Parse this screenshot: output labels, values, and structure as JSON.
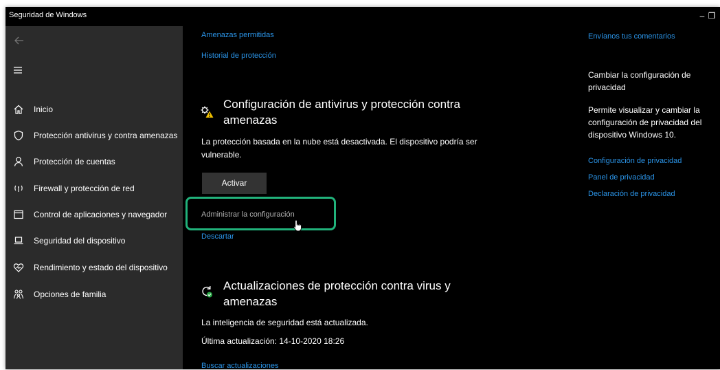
{
  "window": {
    "title": "Seguridad de Windows",
    "minimize": "–",
    "restore": "❐"
  },
  "sidebar": {
    "items": [
      {
        "label": "Inicio",
        "icon": "home-icon"
      },
      {
        "label": "Protección antivirus y contra amenazas",
        "icon": "shield-icon"
      },
      {
        "label": "Protección de cuentas",
        "icon": "person-icon"
      },
      {
        "label": "Firewall y protección de red",
        "icon": "wifi-icon"
      },
      {
        "label": "Control de aplicaciones y navegador",
        "icon": "app-browser-icon"
      },
      {
        "label": "Seguridad del dispositivo",
        "icon": "laptop-icon"
      },
      {
        "label": "Rendimiento y estado del dispositivo",
        "icon": "heart-icon"
      },
      {
        "label": "Opciones de familia",
        "icon": "family-icon"
      }
    ]
  },
  "main": {
    "top_links": {
      "allowed_threats": "Amenazas permitidas",
      "protection_history": "Historial de protección"
    },
    "av_settings": {
      "title": "Configuración de antivirus y protección contra amenazas",
      "description": "La protección basada en la nube está desactivada. El dispositivo podría ser vulnerable.",
      "activate_label": "Activar",
      "manage_label": "Administrar la configuración",
      "dismiss_label": "Descartar"
    },
    "updates": {
      "title": "Actualizaciones de protección contra virus y amenazas",
      "status": "La inteligencia de seguridad está actualizada.",
      "last_update": "Última actualización: 14-10-2020 18:26",
      "check_label": "Buscar actualizaciones"
    }
  },
  "right": {
    "feedback": "Envíanos tus comentarios",
    "privacy_heading": "Cambiar la configuración de privacidad",
    "privacy_text": "Permite visualizar y cambiar la configuración de privacidad del dispositivo Windows 10.",
    "links": {
      "settings": "Configuración de privacidad",
      "dashboard": "Panel de privacidad",
      "statement": "Declaración de privacidad"
    }
  },
  "colors": {
    "link": "#2b95e9",
    "highlight": "#21b27b",
    "sidebar_bg": "#2b2b2b",
    "content_bg": "#000000"
  }
}
